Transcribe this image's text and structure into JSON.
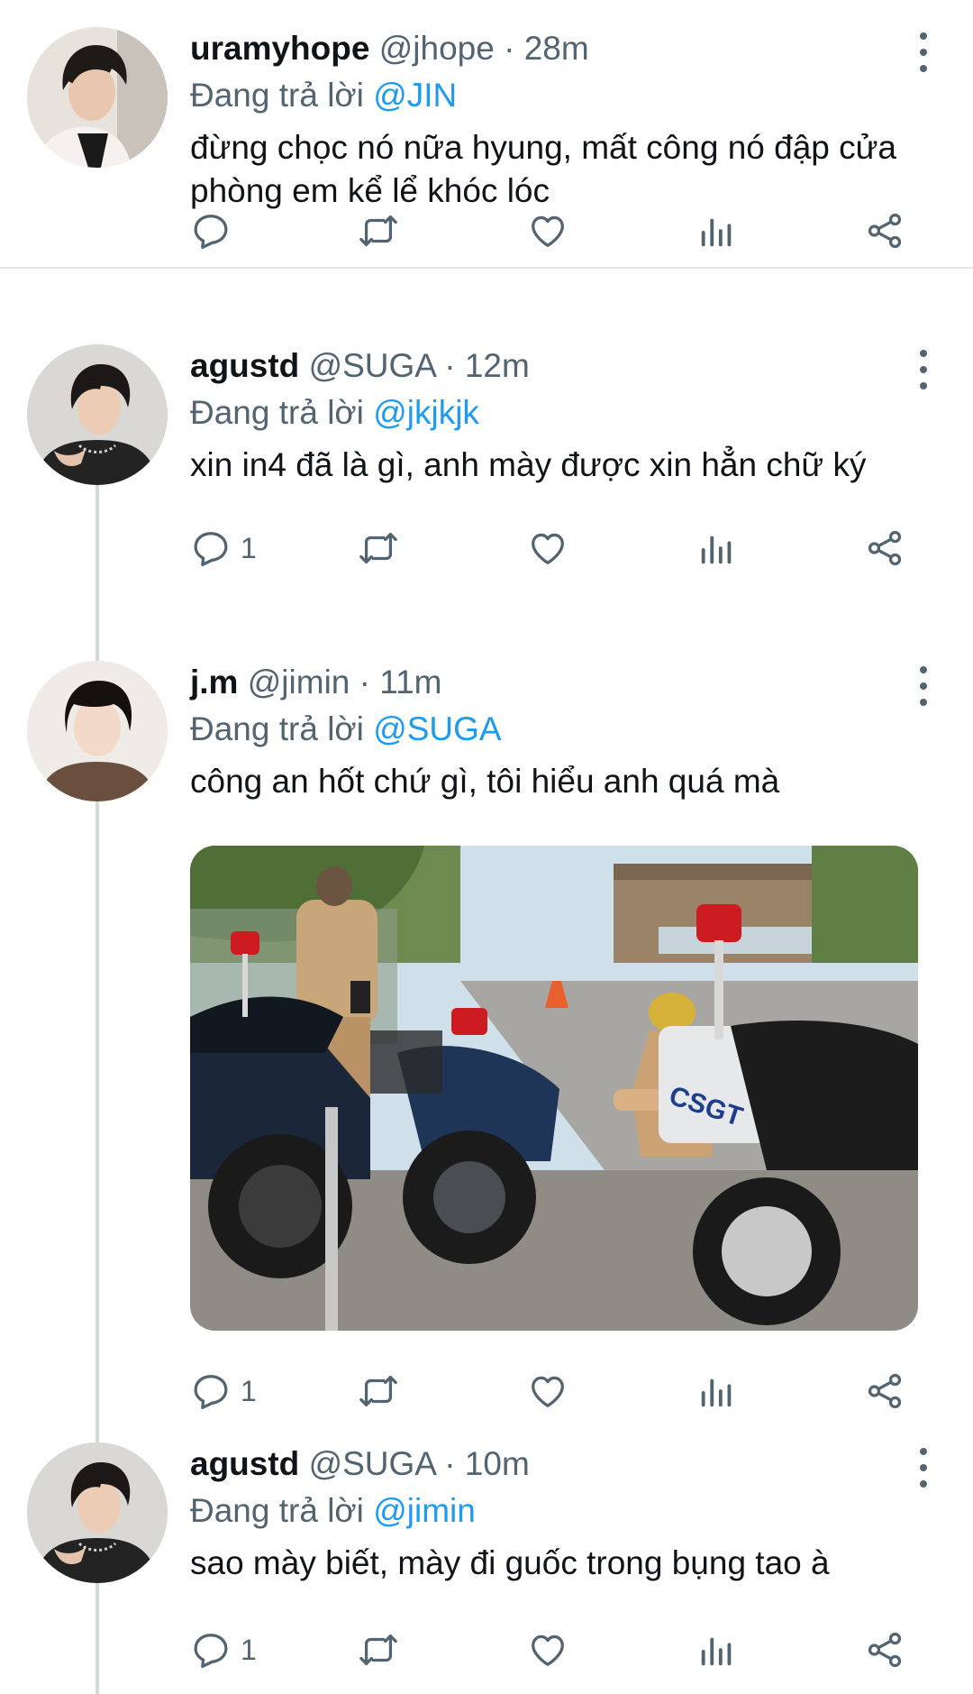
{
  "colors": {
    "accent": "#1d9bf0",
    "secondary_text": "#536471",
    "divider": "#e3e6e8"
  },
  "tweets": [
    {
      "display_name": "uramyhope",
      "handle": "@jhope",
      "separator": "·",
      "time": "28m",
      "reply_prefix": "Đang trả lời",
      "reply_to": "@JIN",
      "text": "đừng chọc nó nữa hyung, mất công nó đập cửa phòng em kể lể khóc lóc",
      "reply_count": "",
      "icons": [
        "reply-icon",
        "retweet-icon",
        "like-icon",
        "views-icon",
        "share-icon"
      ]
    },
    {
      "display_name": "agustd",
      "handle": "@SUGA",
      "separator": "·",
      "time": "12m",
      "reply_prefix": "Đang trả lời",
      "reply_to": "@jkjkjk",
      "text": "xin in4 đã là gì, anh mày được xin hẳn chữ ký",
      "reply_count": "1",
      "icons": [
        "reply-icon",
        "retweet-icon",
        "like-icon",
        "views-icon",
        "share-icon"
      ]
    },
    {
      "display_name": "j.m",
      "handle": "@jimin",
      "separator": "·",
      "time": "11m",
      "reply_prefix": "Đang trả lời",
      "reply_to": "@SUGA",
      "text": "công an hốt chứ gì, tôi hiểu anh quá mà",
      "media": "photo-traffic-police-motorbikes",
      "media_text": "CSGT",
      "reply_count": "1",
      "icons": [
        "reply-icon",
        "retweet-icon",
        "like-icon",
        "views-icon",
        "share-icon"
      ]
    },
    {
      "display_name": "agustd",
      "handle": "@SUGA",
      "separator": "·",
      "time": "10m",
      "reply_prefix": "Đang trả lời",
      "reply_to": "@jimin",
      "text": "sao mày biết, mày đi guốc trong bụng tao à",
      "reply_count": "1",
      "icons": [
        "reply-icon",
        "retweet-icon",
        "like-icon",
        "views-icon",
        "share-icon"
      ]
    }
  ]
}
